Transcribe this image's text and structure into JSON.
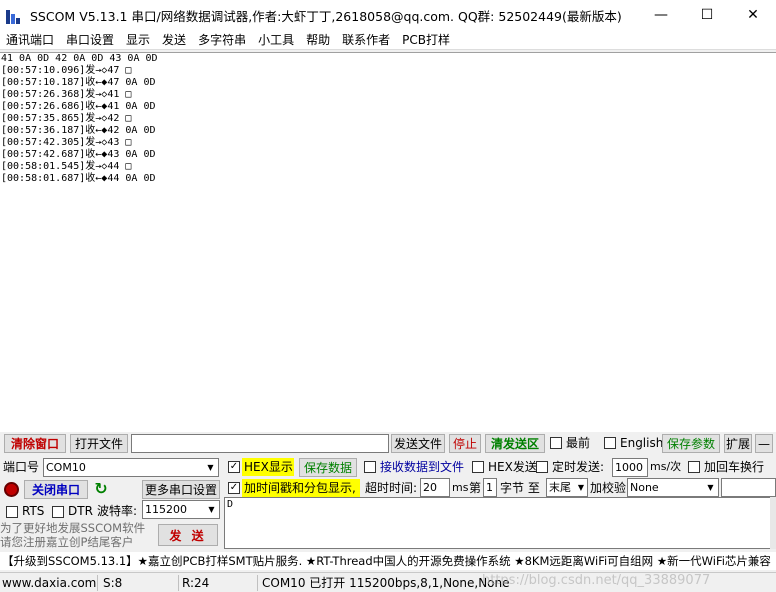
{
  "window": {
    "title": "SSCOM V5.13.1 串口/网络数据调试器,作者:大虾丁丁,2618058@qq.com. QQ群: 52502449(最新版本)",
    "minimize": "—",
    "maximize": "☐",
    "close": "✕"
  },
  "menu": [
    "通讯端口",
    "串口设置",
    "显示",
    "发送",
    "多字符串",
    "小工具",
    "帮助",
    "联系作者",
    "PCB打样"
  ],
  "receive_lines": [
    "41 0A 0D 42 0A 0D 43 0A 0D",
    "[00:57:10.096]发→◇47 □",
    "[00:57:10.187]收←◆47 0A 0D",
    "[00:57:26.368]发→◇41 □",
    "[00:57:26.686]收←◆41 0A 0D",
    "[00:57:35.865]发→◇42 □",
    "[00:57:36.187]收←◆42 0A 0D",
    "[00:57:42.305]发→◇43 □",
    "[00:57:42.687]收←◆43 0A 0D",
    "[00:58:01.545]发→◇44 □",
    "[00:58:01.687]收←◆44 0A 0D"
  ],
  "toolbar": {
    "clear_window": "清除窗口",
    "open_file": "打开文件",
    "file_path": "",
    "send_file": "发送文件",
    "stop": "停止",
    "clear_send": "清发送区",
    "topmost": "最前",
    "english": "English",
    "save_params": "保存参数",
    "expand": "扩展",
    "collapse": "—"
  },
  "port": {
    "port_label": "端口号",
    "port_value": "COM10",
    "close_port": "关闭串口",
    "more_settings": "更多串口设置",
    "rts": "RTS",
    "dtr": "DTR",
    "baud_label": "波特率:",
    "baud_value": "115200",
    "promo": "为了更好地发展SSCOM软件\n请您注册嘉立创P结尾客户"
  },
  "options": {
    "hex_display": "HEX显示",
    "hex_display_checked": true,
    "save_data": "保存数据",
    "recv_to_file": "接收数据到文件",
    "hex_send": "HEX发送",
    "timed_send": "定时发送:",
    "interval": "1000",
    "interval_unit": "ms/次",
    "add_crlf": "加回车换行",
    "timestamp": "加时间戳和分包显示,",
    "timestamp_checked": true,
    "timeout_label": "超时时间:",
    "timeout_value": "20",
    "timeout_unit": "ms",
    "nth_label": "第",
    "nth_value": "1",
    "byte_label": "字节 至",
    "end_value": "末尾",
    "checksum_label": "加校验",
    "checksum_value": "None"
  },
  "send": {
    "send_button": "发 送",
    "send_text": "D"
  },
  "ad_text": "【升级到SSCOM5.13.1】★嘉立创PCB打样SMT贴片服务. ★RT-Thread中国人的开源免费操作系统 ★8KM远距离WiFi可自组网 ★新一代WiFi芯片兼容",
  "status": {
    "website": "www.daxia.com",
    "sent": "S:8",
    "received": "R:24",
    "port_status": "COM10 已打开  115200bps,8,1,None,None",
    "watermark": "https://blog.csdn.net/qq_33889077"
  }
}
